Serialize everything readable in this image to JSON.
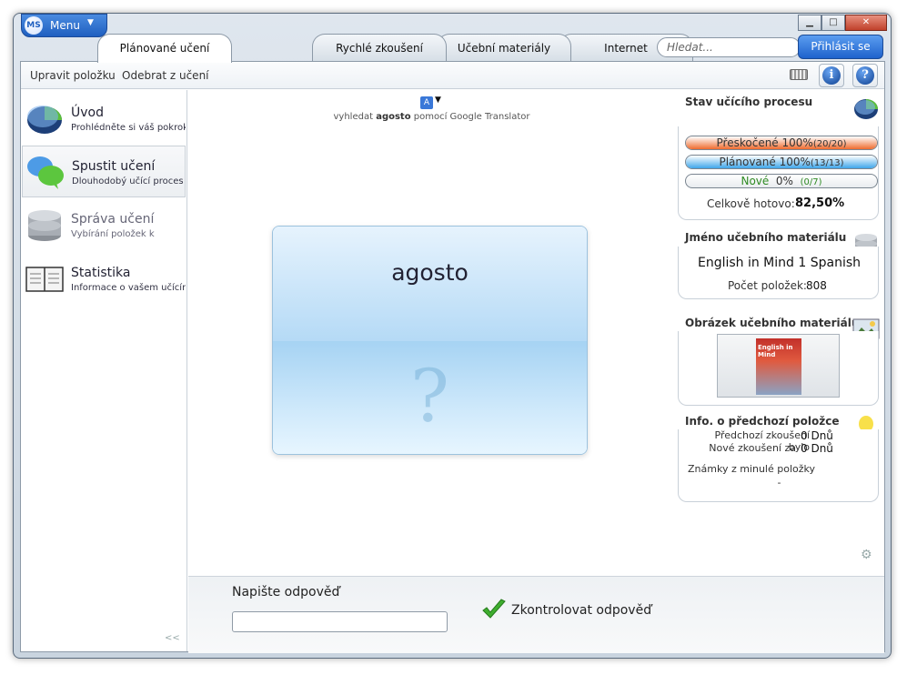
{
  "titlebar": {
    "menu_label": "Menu",
    "logo_text": "MS"
  },
  "tabs": [
    {
      "label": "Plánované učení",
      "active": true
    },
    {
      "label": "Rychlé zkoušení",
      "active": false
    },
    {
      "label": "Učební materiály",
      "active": false
    },
    {
      "label": "Internet",
      "active": false
    }
  ],
  "search": {
    "placeholder": "Hledat..."
  },
  "login_label": "Přihlásit se",
  "toolbar": {
    "edit_label": "Upravit položku",
    "remove_label": "Odebrat z učení",
    "info_label": "i",
    "help_label": "?"
  },
  "sidebar": {
    "items": [
      {
        "title": "Úvod",
        "subtitle": "Prohlédněte si váš pokrok"
      },
      {
        "title": "Spustit učení",
        "subtitle": "Dlouhodobý učící proces"
      },
      {
        "title": "Správa učení",
        "subtitle": "Vybírání položek k"
      },
      {
        "title": "Statistika",
        "subtitle": "Informace o vašem učícím"
      }
    ],
    "collapse_label": "<<"
  },
  "center": {
    "translate_prefix": "vyhledat",
    "translate_word": "agosto",
    "translate_suffix": "pomocí Google Translator",
    "card_word": "agosto",
    "card_question": "?"
  },
  "answer": {
    "label": "Napište odpověď",
    "value": "",
    "check_label": "Zkontrolovat odpověď"
  },
  "status": {
    "heading": "Stav učícího procesu",
    "skipped": {
      "label": "Přeskočené",
      "percent": "100%",
      "count": "(20/20)",
      "color": "#ef6b2e",
      "fill": 1.0
    },
    "planned": {
      "label": "Plánované",
      "percent": "100%",
      "count": "(13/13)",
      "color": "#3fa6ea",
      "fill": 1.0
    },
    "new": {
      "label": "Nové",
      "percent": "0%",
      "count": "(0/7)",
      "color": "#4caf50",
      "fill": 0.0
    },
    "total_label": "Celkově hotovo:",
    "total_value": "82,50%"
  },
  "material": {
    "heading": "Jméno učebního materiálu",
    "name": "English in Mind 1 Spanish",
    "count_label": "Počet položek:",
    "count_value": "808"
  },
  "image": {
    "heading": "Obrázek učebního materiálu",
    "cover_text": "English in Mind"
  },
  "previous": {
    "heading": "Info. o předchozí položce",
    "prev_label": "Předchozí zkoušení bylo",
    "prev_value": "0 Dnů",
    "next_label": "Nové zkoušení za",
    "next_value": "0 Dnů",
    "grades_label": "Známky z minulé položky",
    "grades_value": "-"
  }
}
